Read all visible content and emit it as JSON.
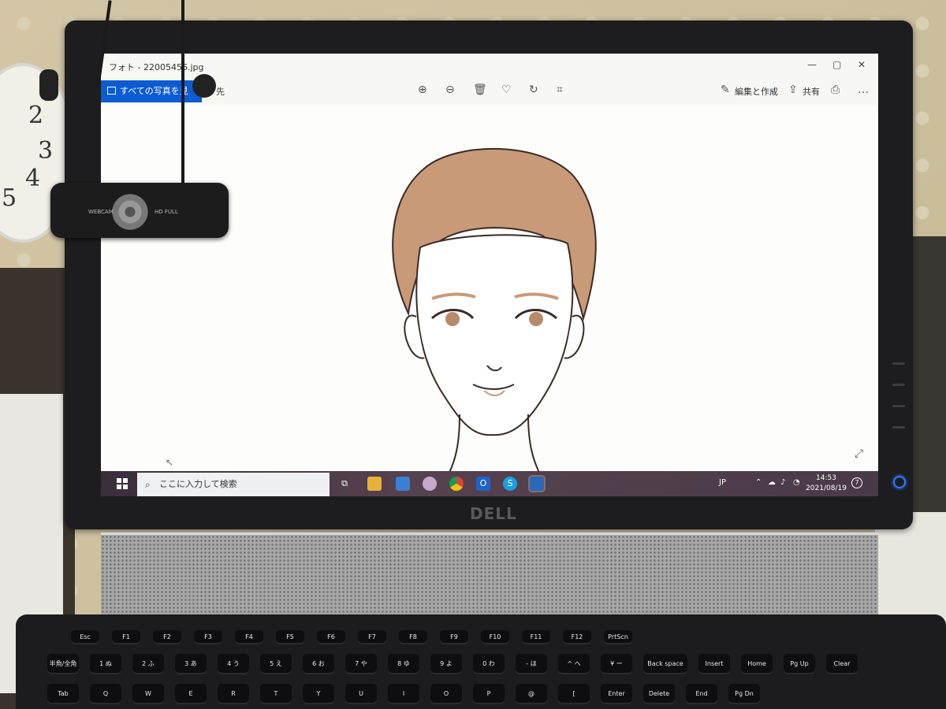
{
  "window": {
    "title": "フォト - 22005456.jpg",
    "controls": {
      "minimize": "—",
      "maximize": "▢",
      "close": "✕"
    }
  },
  "toolbar": {
    "all_photos_label": "すべての写真を見",
    "all_photos_truncated_tail": "先",
    "edit_create_label": "編集と作成",
    "share_label": "共有",
    "icons": [
      "zoom-in-icon",
      "zoom-out-icon",
      "delete-icon",
      "favorite-icon",
      "rotate-icon",
      "crop-icon",
      "print-icon",
      "more-icon"
    ]
  },
  "taskbar": {
    "search_placeholder": "ここに入力して検索",
    "lang": "JP",
    "time": "14:53",
    "date": "2021/08/19",
    "notification_count": "7",
    "apps": [
      "task-view",
      "file-explorer",
      "store",
      "paint",
      "chrome",
      "outlook",
      "skype",
      "photos"
    ]
  },
  "colors": {
    "accent": "#0b5bd2",
    "taskbar": "#4a3a48",
    "hair": "#c99a78",
    "iris": "#b98a6a",
    "line": "#3a2b25"
  },
  "hardware": {
    "monitor_brand": "DELL",
    "webcam_left_label": "WEBCAM",
    "webcam_right_label": "HD FULL",
    "keys_row1": [
      "Esc",
      "F1",
      "F2",
      "F3",
      "F4",
      "F5",
      "F6",
      "F7",
      "F8",
      "F9",
      "F10",
      "F11",
      "F12",
      "PrtScn"
    ],
    "keys_row2": [
      "半角/全角",
      "1 ぬ",
      "2 ふ",
      "3 あ",
      "4 う",
      "5 え",
      "6 お",
      "7 や",
      "8 ゆ",
      "9 よ",
      "0 わ",
      "- ほ",
      "^ へ",
      "¥ ー",
      "Back space",
      "Insert",
      "Home",
      "Pg Up",
      "Clear"
    ],
    "keys_row3": [
      "Tab",
      "Q",
      "W",
      "E",
      "R",
      "T",
      "Y",
      "U",
      "I",
      "O",
      "P",
      "@",
      "[",
      "Enter",
      "Delete",
      "End",
      "Pg Dn"
    ]
  }
}
